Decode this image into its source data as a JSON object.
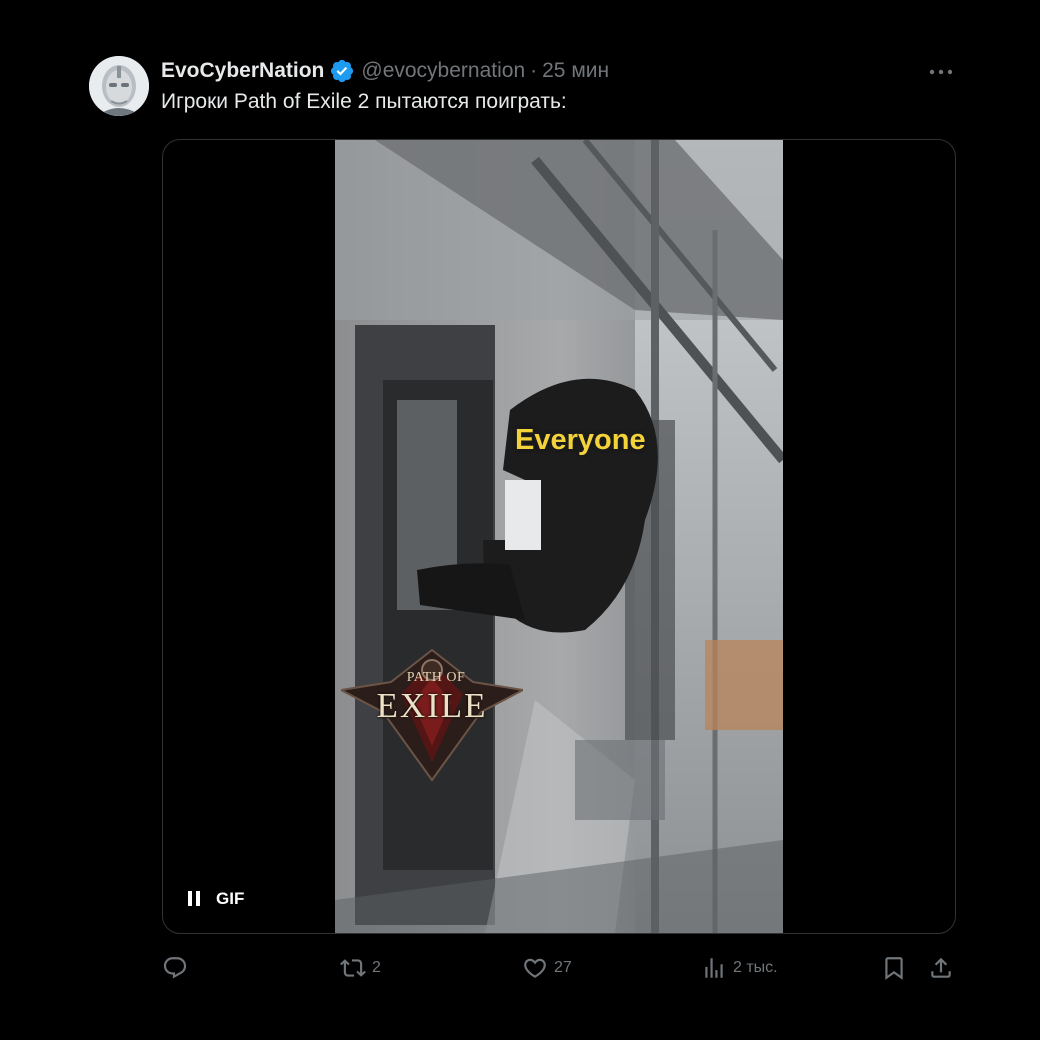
{
  "tweet": {
    "display_name": "EvoCyberNation",
    "handle": "@evocybernation",
    "separator": "·",
    "timestamp": "25 мин",
    "text": "Игроки Path of Exile 2 пытаются поиграть:",
    "verified": true
  },
  "media": {
    "caption": "Everyone",
    "logo_top_text": "PATH OF",
    "logo_main_text": "EXILE",
    "badge": "GIF",
    "state": "playing"
  },
  "actions": {
    "reply_count": "",
    "retweet_count": "2",
    "like_count": "27",
    "views_count": "2 тыс."
  },
  "colors": {
    "background": "#000000",
    "primary_text": "#e7e9ea",
    "secondary_text": "#71767b",
    "verified_badge": "#1d9bf0",
    "caption": "#f4d33a",
    "border": "#2f3336"
  },
  "icons": [
    "verified-badge-icon",
    "more-icon",
    "pause-icon",
    "reply-icon",
    "retweet-icon",
    "like-icon",
    "views-icon",
    "bookmark-icon",
    "share-icon"
  ]
}
